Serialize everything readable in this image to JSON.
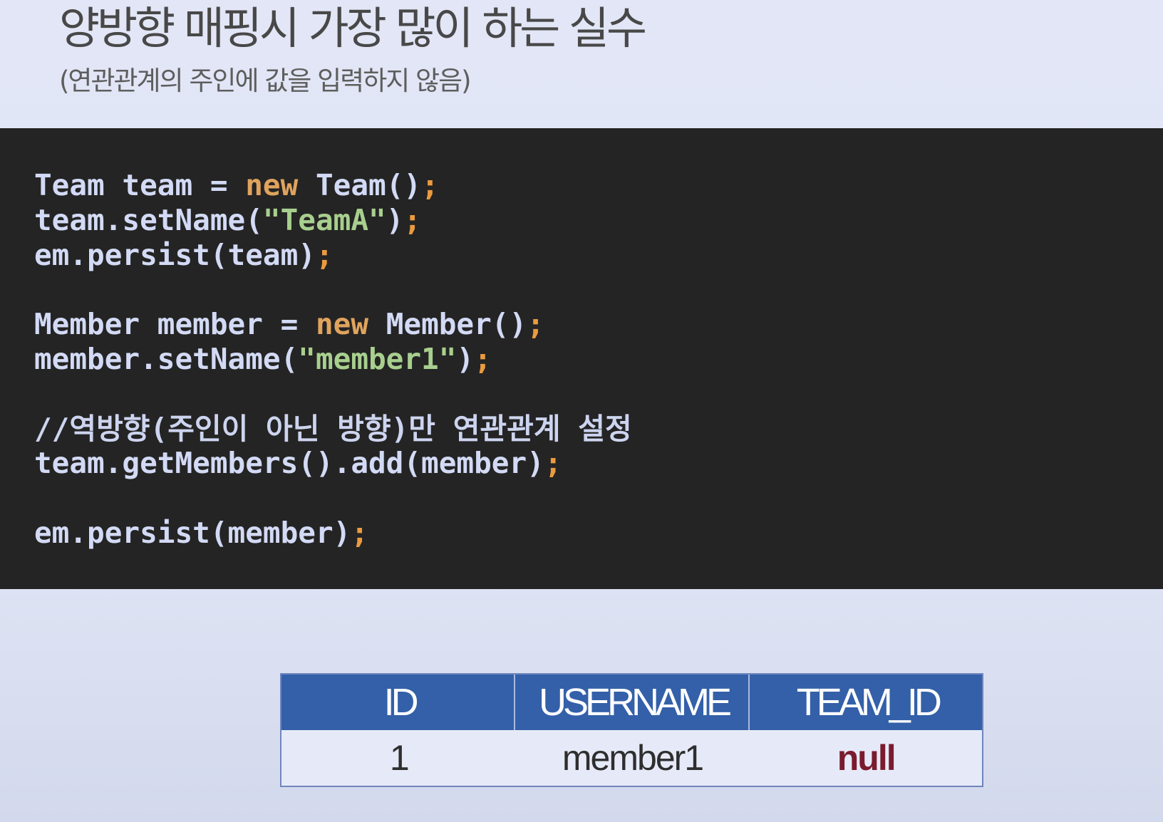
{
  "slide": {
    "title": "양방향 매핑시 가장 많이 하는 실수",
    "subtitle": "(연관관계의 주인에 값을 입력하지 않음)"
  },
  "code": {
    "lines": [
      {
        "tokens": [
          "Team team = ",
          "new",
          " Team()",
          ";"
        ]
      },
      {
        "tokens": [
          "team.setName(",
          "\"TeamA\"",
          ")",
          ";"
        ]
      },
      {
        "tokens": [
          "em.persist(team)",
          ";"
        ]
      },
      {
        "tokens": [
          "Member member = ",
          "new",
          " Member()",
          ";"
        ]
      },
      {
        "tokens": [
          "member.setName(",
          "\"member1\"",
          ")",
          ";"
        ]
      },
      {
        "tokens": [
          "//역방향(주인이 아닌 방향)만 연관관계 설정"
        ]
      },
      {
        "tokens": [
          "team.getMembers().add(member)",
          ";"
        ]
      },
      {
        "tokens": [
          "em.persist(member)",
          ";"
        ]
      }
    ]
  },
  "table": {
    "columns": [
      "ID",
      "USERNAME",
      "TEAM_ID"
    ],
    "rows": [
      [
        "1",
        "member1",
        "null"
      ]
    ]
  },
  "colors": {
    "background_top": "#e2e6f6",
    "background": "#dee3f4",
    "background_bottom": "#d3d9ec",
    "title_text": "#484848",
    "subtitle_text": "#5e5e5e",
    "code_background": "#242424",
    "code_text": "#d3daf5",
    "code_keyword": "#e0a35e",
    "code_semicolon": "#eb9a3f",
    "code_string": "#a8cf8e",
    "code_comment": "#cdd4ef",
    "table_border": "#6f85bd",
    "table_header": "#3460a9",
    "table_header_divider": "#a9b9df",
    "table_header_text": "#ffffff",
    "table_row": "#e6eaf8",
    "table_cell_text": "#2e2e2e",
    "null_value": "#7a1b2e"
  }
}
